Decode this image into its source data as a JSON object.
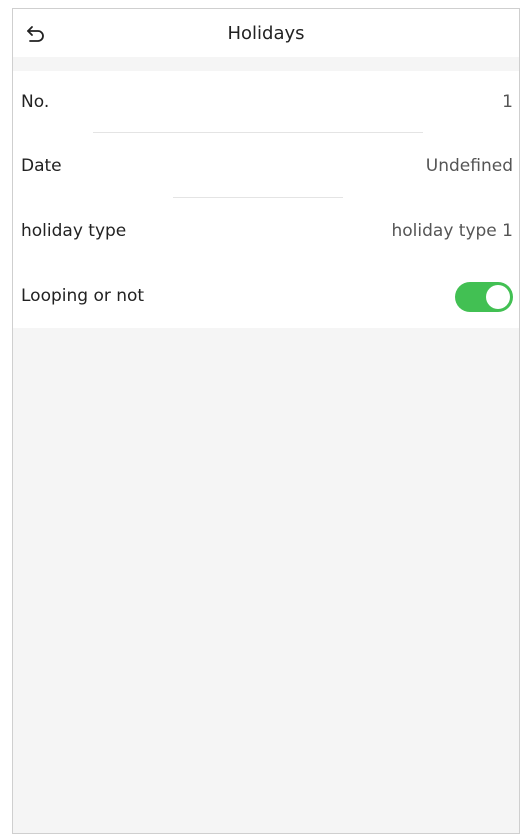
{
  "header": {
    "title": "Holidays",
    "back_icon": "back-arrow-icon"
  },
  "rows": [
    {
      "label": "No.",
      "value": "1"
    },
    {
      "label": "Date",
      "value": "Undefined"
    },
    {
      "label": "holiday type",
      "value": "holiday type 1"
    },
    {
      "label": "Looping or not",
      "toggle_on": true
    }
  ],
  "colors": {
    "accent": "#42c053",
    "background": "#f5f5f5",
    "panel": "#ffffff"
  }
}
